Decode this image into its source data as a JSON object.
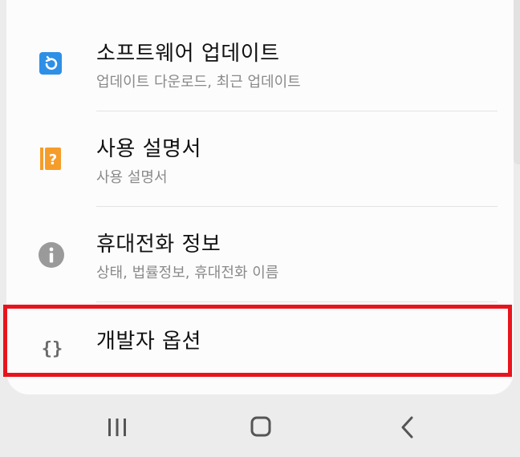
{
  "menu": {
    "items": [
      {
        "title": "소프트웨어 업데이트",
        "subtitle": "업데이트 다운로드, 최근 업데이트",
        "icon": "software-update-icon",
        "color": "#2e8fe6"
      },
      {
        "title": "사용 설명서",
        "subtitle": "사용 설명서",
        "icon": "user-manual-icon",
        "color": "#f59d2a"
      },
      {
        "title": "휴대전화 정보",
        "subtitle": "상태, 법률정보, 휴대전화 이름",
        "icon": "info-icon",
        "color": "#9a9a9a"
      },
      {
        "title": "개발자 옵션",
        "icon": "developer-options-icon",
        "color": "#6b6b6b"
      }
    ]
  },
  "highlight_color": "#e8141d",
  "navbar": {
    "buttons": [
      "recent-apps-icon",
      "home-icon",
      "back-icon"
    ]
  }
}
